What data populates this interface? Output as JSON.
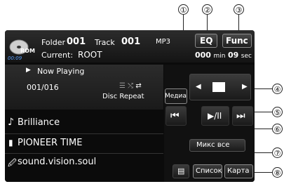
{
  "callouts": [
    "①",
    "②",
    "③",
    "④",
    "⑤",
    "⑥",
    "⑦",
    "⑧"
  ],
  "header": {
    "folder_label": "Folder",
    "folder_value": "001",
    "track_label": "Track",
    "track_value": "001",
    "format": "MP3",
    "current_label": "Current:",
    "current_value": "ROOT",
    "elapsed_counter": "00:09",
    "disc_icon_label": "ROM",
    "time_min": "000",
    "time_min_unit": "min",
    "time_sec": "09",
    "time_sec_unit": "sec"
  },
  "buttons": {
    "eq": "EQ",
    "func": "Func",
    "media": "Медиа",
    "shuffle_all": "Микс все",
    "list": "Список",
    "map": "Карта"
  },
  "now_playing": {
    "label": "Now Playing",
    "track_position": "001/016",
    "repeat_mode": "Disc Repeat",
    "song_title": "Brilliance",
    "artist": "PIONEER TIME",
    "album": "sound.vision.soul"
  },
  "icons": {
    "prev": "previous-track-icon",
    "play_pause": "play-pause-icon",
    "next": "next-track-icon",
    "folder": "folder-icon",
    "left_arrow": "left-arrow-icon",
    "right_arrow": "right-arrow-icon",
    "note": "music-note-icon",
    "person": "artist-icon",
    "disc": "album-icon",
    "list_icon": "list-icon"
  },
  "colors": {
    "screen_bg": "#0b0b0b",
    "accent_blue": "#2f6fd1"
  }
}
